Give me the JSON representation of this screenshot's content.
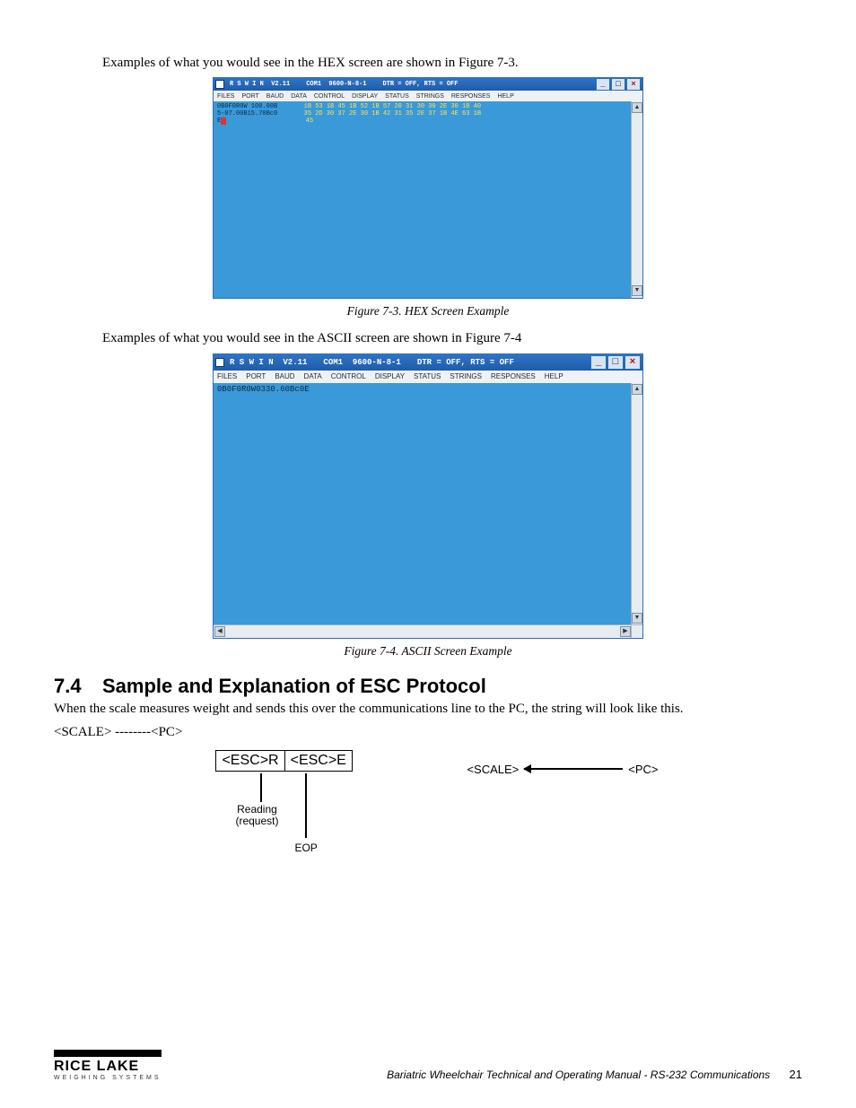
{
  "intro_hex": "Examples of what you would see in the HEX screen are shown in Figure 7-3.",
  "intro_ascii": "Examples of what you would see in the ASCII screen are shown in Figure 7-4",
  "caption1": "Figure 7-3. HEX Screen Example",
  "caption2": "Figure 7-4. ASCII Screen Example",
  "section": {
    "num": "7.4",
    "title": "Sample and Explanation of ESC Protocol"
  },
  "section_body": "When the scale measures weight and sends this over the communications line to the PC, the string will look like this.",
  "proto_line": "<SCALE> --------<PC>",
  "esc": {
    "cell1": "<ESC>R",
    "cell2": "<ESC>E",
    "label_reading": "Reading",
    "label_request": "(request)",
    "label_eop": "EOP",
    "arrow_left": "<SCALE>",
    "arrow_right": "<PC>"
  },
  "rswin": {
    "title_app": "R S W I N  V2.11",
    "title_port": "COM1  9600-N-8-1",
    "title_dtr": "DTR = OFF, RTS = OFF",
    "menus": [
      "FILES",
      "PORT",
      "BAUD",
      "DATA",
      "CONTROL",
      "DISPLAY",
      "STATUS",
      "STRINGS",
      "RESPONSES",
      "HELP"
    ],
    "hex": {
      "l1a": "0B0F0R0W 100.00B",
      "l1b": "1B 53 1B 45 1B 52 1B 57 20 31 30 30 2E 30 1B 40",
      "l2a": "5-07.00B15.70Bc0",
      "l2b": "35 2D 30 37 2E 30 1B 42 31 35 2E 37 1B 4E 63 1B",
      "l3a": "E",
      "l3b": "45"
    },
    "ascii": {
      "l1": "0B0F0R0W0330.60Bc0E"
    }
  },
  "footer": {
    "logo_name": "RICE LAKE",
    "logo_sub": "WEIGHING SYSTEMS",
    "text": "Bariatric Wheelchair Technical and Operating Manual - RS-232 Communications",
    "page": "21"
  }
}
